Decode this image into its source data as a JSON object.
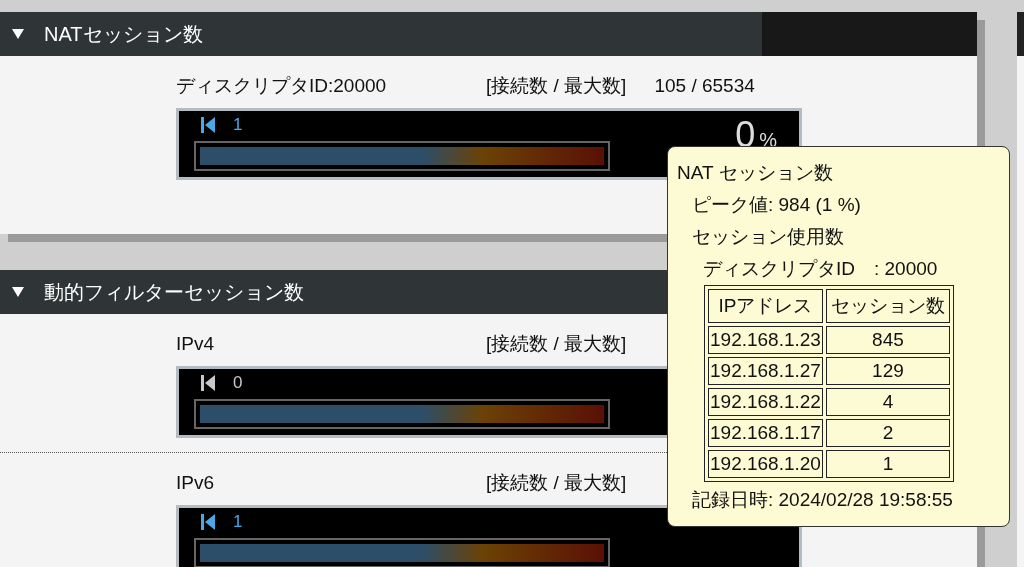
{
  "sections": [
    {
      "title": "NATセッション数",
      "expanded": true,
      "meters": [
        {
          "label": "ディスクリプタID:20000",
          "header": "[接続数 / 最大数]",
          "reading": "105 / 65534",
          "peak": "1",
          "highlighted": true,
          "percent": "0",
          "unit": "%"
        }
      ]
    },
    {
      "title": "動的フィルターセッション数",
      "expanded": true,
      "meters": [
        {
          "label": "IPv4",
          "header": "[接続数 / 最大数]",
          "peak": "0",
          "highlighted": false
        },
        {
          "label": "IPv6",
          "header": "[接続数 / 最大数]",
          "peak": "1",
          "highlighted": true
        }
      ]
    }
  ],
  "tooltip": {
    "title": "NAT セッション数",
    "peak": "ピーク値: 984 (1 %)",
    "usage": "セッション使用数",
    "descriptor": "ディスクリプタID　: 20000",
    "columns": [
      "IPアドレス",
      "セッション数"
    ],
    "rows": [
      [
        "192.168.1.23",
        "845"
      ],
      [
        "192.168.1.27",
        "129"
      ],
      [
        "192.168.1.22",
        "4"
      ],
      [
        "192.168.1.17",
        "2"
      ],
      [
        "192.168.1.20",
        "1"
      ]
    ],
    "recorded": "記録日時: 2024/02/28 19:58:55"
  }
}
